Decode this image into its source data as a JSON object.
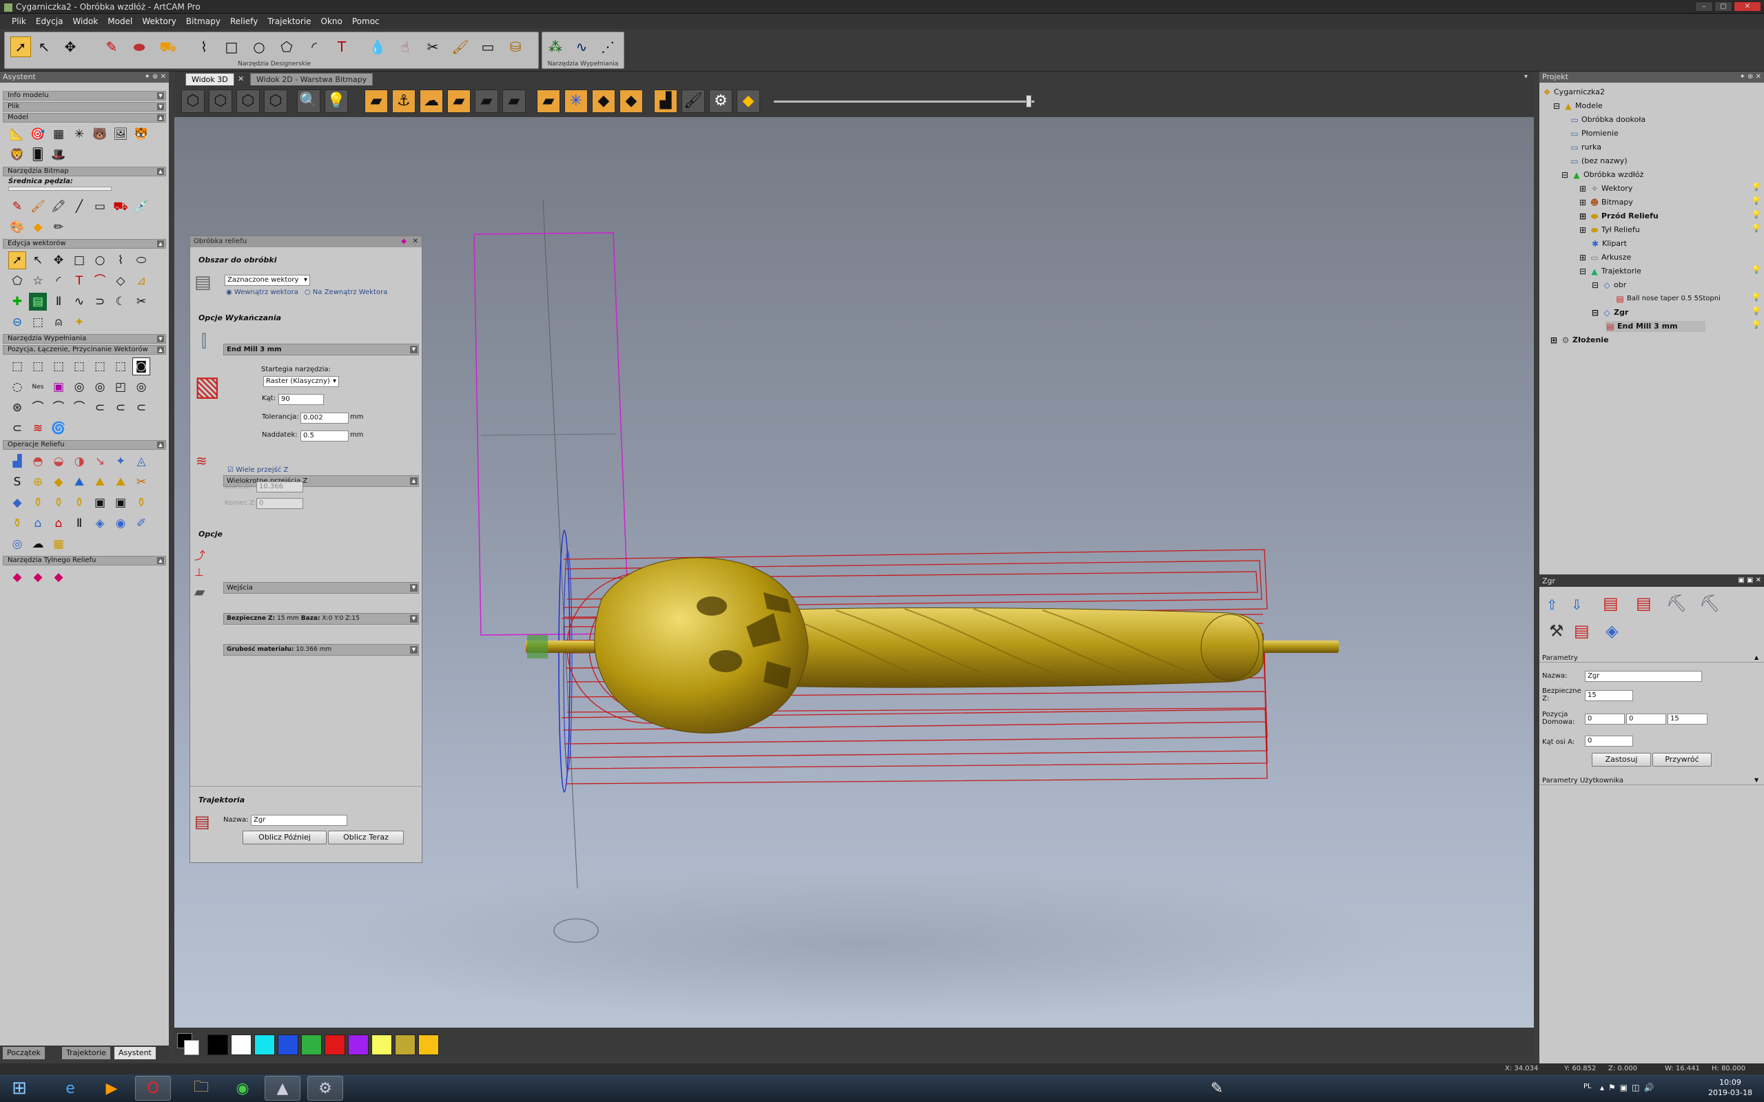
{
  "window": {
    "title": "Cygarniczka2 - Obróbka wzdłóż - ArtCAM Pro",
    "buttons": [
      "–",
      "▢",
      "✕"
    ]
  },
  "menu": [
    "Plik",
    "Edycja",
    "Widok",
    "Model",
    "Wektory",
    "Bitmapy",
    "Reliefy",
    "Trajektorie",
    "Okno",
    "Pomoc"
  ],
  "toolbar": {
    "group1_label": "Narzędzia Designerskie",
    "group2_label": "Narzędzia Wypełniania"
  },
  "assistant": {
    "title": "Asystent",
    "sections": {
      "info": "Info modelu",
      "file": "Plik",
      "model": "Model",
      "bitmap_tools": "Narzędzia Bitmap",
      "brush_label": "Średnica pędzla:",
      "vector_edit": "Edycja wektorów",
      "fill_tools": "Narzędzia Wypełniania",
      "position": "Pozycja, Łączenie, Przycinanie Wektorów",
      "relief_ops": "Operacje Reliefu",
      "back_relief": "Narzędzia Tylnego Reliefu"
    },
    "bottom_tabs": [
      "Początek",
      "Trajektorie",
      "Asystent"
    ]
  },
  "tabs": [
    "Widok 3D",
    "Widok 2D - Warstwa Bitmapy"
  ],
  "dialog": {
    "title": "Obróbka reliefu",
    "area_title": "Obszar do obróbki",
    "area_select": "Zaznaczone wektory",
    "radio_inside": "Wewnątrz wektora",
    "radio_outside": "Na Zewnątrz Wektora",
    "finish_title": "Opcje Wykańczania",
    "tool": "End Mill 3 mm",
    "strategy_label": "Startegia narzędzia:",
    "strategy_value": "Raster (Klasyczny)",
    "angle_label": "Kąt:",
    "angle_value": "90",
    "tolerance_label": "Tolerancja:",
    "tolerance_value": "0.002",
    "allowance_label": "Naddatek:",
    "allowance_value": "0.5",
    "unit": "mm",
    "multi_title": "Wielokrotne przejścia Z",
    "multi_check": "Wiele przejść Z",
    "start_label": "Start Z:",
    "start_value": "10.366",
    "end_label": "Koniec Z:",
    "end_value": "0",
    "options_title": "Opcje",
    "entries": "Wejścia",
    "safe_z_label": "Bezpieczne Z:",
    "safe_z_value": "15 mm",
    "home_label": "Baza:",
    "home_value": "X:0 Y:0 Z:15",
    "thickness_label": "Grubość materiału:",
    "thickness_value": "10.366 mm",
    "toolpath_title": "Trajektoria",
    "name_label": "Nazwa:",
    "name_value": "Zgr",
    "calc_later": "Oblicz Później",
    "calc_now": "Oblicz Teraz"
  },
  "project": {
    "title": "Projekt",
    "tree": [
      {
        "label": "Cygarniczka2",
        "bold": false
      },
      {
        "label": "Modele",
        "bold": false
      },
      {
        "label": "Obróbka dookoła",
        "bold": false
      },
      {
        "label": "Płomienie",
        "bold": false
      },
      {
        "label": "rurka",
        "bold": false
      },
      {
        "label": "(bez nazwy)",
        "bold": false
      },
      {
        "label": "Obróbka wzdłóż",
        "bold": false
      },
      {
        "label": "Wektory",
        "bold": false
      },
      {
        "label": "Bitmapy",
        "bold": false
      },
      {
        "label": "Przód Reliefu",
        "bold": true
      },
      {
        "label": "Tył Reliefu",
        "bold": false
      },
      {
        "label": "Klipart",
        "bold": false
      },
      {
        "label": "Arkusze",
        "bold": false
      },
      {
        "label": "Trajektorie",
        "bold": false
      },
      {
        "label": "obr",
        "bold": false
      },
      {
        "label": "Ball nose taper 0.5 5Stopni",
        "bold": false
      },
      {
        "label": "Zgr",
        "bold": true
      },
      {
        "label": "End Mill 3 mm",
        "bold": true
      },
      {
        "label": "Złożenie",
        "bold": true
      }
    ]
  },
  "zgr_panel": {
    "title": "Zgr",
    "params": "Parametry",
    "name_label": "Nazwa:",
    "name_value": "Zgr",
    "safe_label": "Bezpieczne Z:",
    "safe_value": "15",
    "home_label": "Pozycja Domowa:",
    "home_x": "0",
    "home_y": "0",
    "home_z": "15",
    "a_label": "Kąt osi A:",
    "a_value": "0",
    "apply": "Zastosuj",
    "restore": "Przywróć",
    "user_params": "Parametry Użytkownika"
  },
  "status": {
    "x": "X: 34.034",
    "y": "Y: 60.852",
    "z": "Z: 0.000",
    "w": "W: 16.441",
    "h": "H: 80.000"
  },
  "taskbar": {
    "lang": "PL",
    "time": "10:09",
    "date": "2019-03-18"
  },
  "palette_colors": [
    "#000000",
    "#ffffff",
    "#14e4f0",
    "#2050e0",
    "#30b040",
    "#e01818",
    "#a020f0",
    "#f8f860",
    "#c0a830",
    "#f8c010"
  ]
}
